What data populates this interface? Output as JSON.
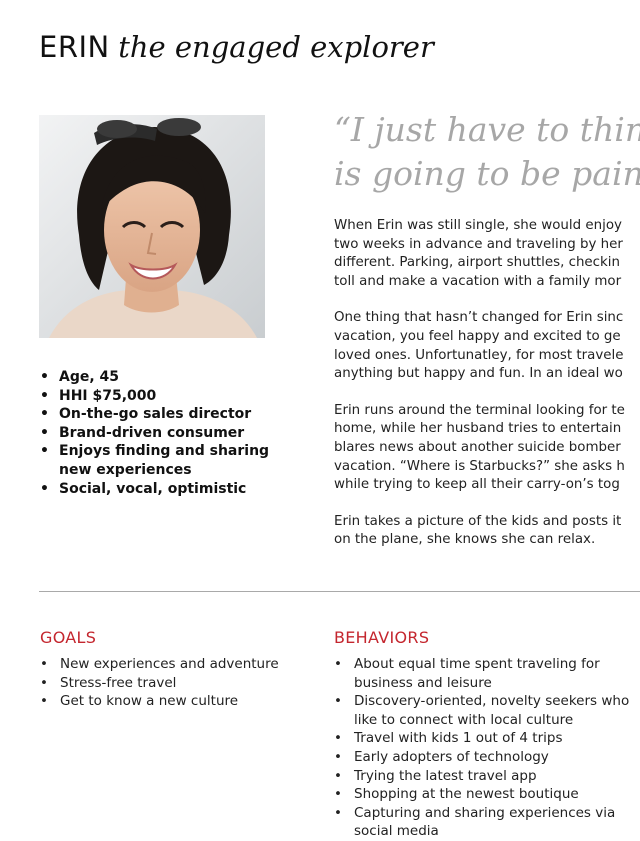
{
  "header": {
    "name": "ERIN",
    "tagline": "the engaged explorer"
  },
  "persona_traits": [
    "Age, 45",
    "HHI $75,000",
    "On-the-go sales director",
    "Brand-driven consumer",
    "Enjoys finding and sharing new experiences",
    "Social, vocal, optimistic"
  ],
  "quote": {
    "line1": "“I just have to think",
    "line2": "is going to be painf"
  },
  "story": [
    [
      "When Erin was still single, she would enjoy",
      "two weeks in advance and traveling by her",
      "different. Parking, airport shuttles, checkin",
      "toll and make a vacation with a family mor"
    ],
    [
      "One thing that hasn’t changed for Erin sinc",
      "vacation, you feel happy and excited to ge",
      "loved ones. Unfortunatley, for most travele",
      "anything but happy and fun. In an ideal wo"
    ],
    [
      "Erin runs around the terminal looking for te",
      "home, while her husband tries to entertain",
      "blares news about another suicide bomber",
      "vacation. “Where is Starbucks?” she asks h",
      "while trying to keep all their carry-on’s tog"
    ],
    [
      "Erin takes a picture of the kids and posts it",
      "on the plane, she knows she can relax."
    ]
  ],
  "goals": {
    "heading": "GOALS",
    "items": [
      "New experiences and adventure",
      "Stress-free travel",
      "Get to know a new culture"
    ]
  },
  "behaviors": {
    "heading": "BEHAVIORS",
    "items": [
      "About equal time spent traveling for business and leisure",
      "Discovery-oriented, novelty seekers who like to connect with local culture",
      "Travel with kids 1 out of 4 trips",
      "Early adopters of technology",
      "Trying the latest travel app",
      "Shopping at the newest boutique",
      "Capturing and sharing experiences via social media"
    ]
  },
  "colors": {
    "accent_red": "#c4262e",
    "quote_gray": "#a7a7a7",
    "divider_gray": "#a9a9a9"
  }
}
